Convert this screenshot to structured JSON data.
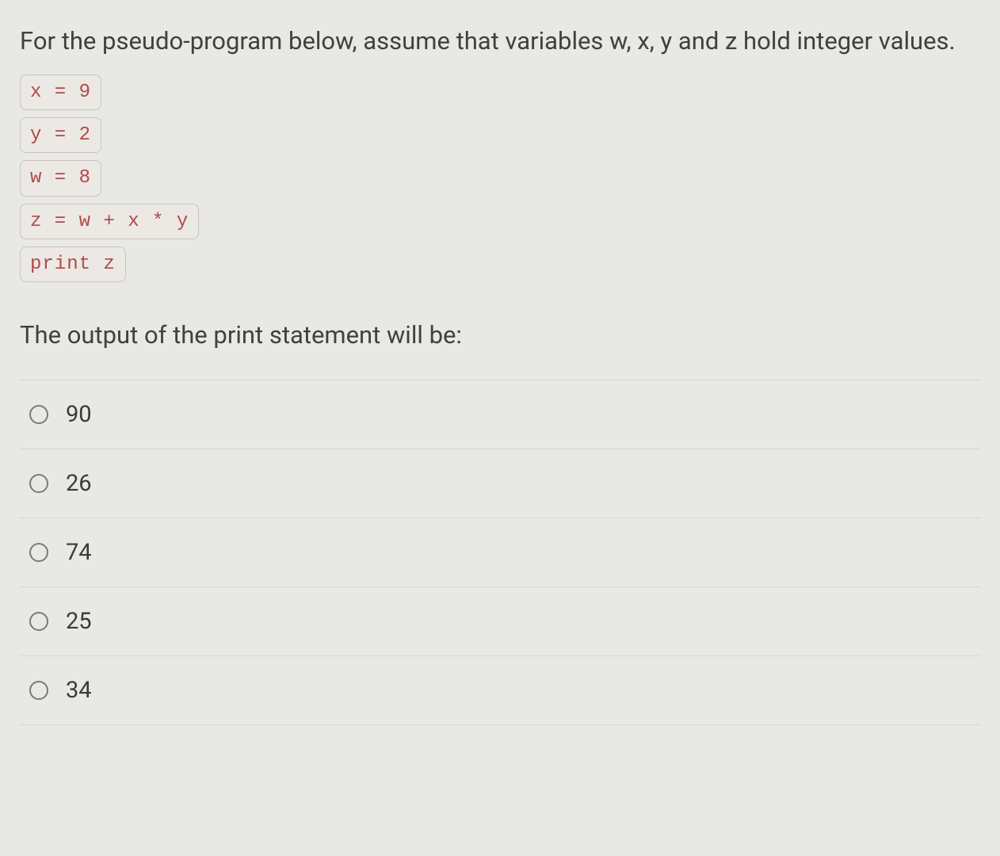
{
  "question": {
    "intro": "For the pseudo-program below, assume that variables w, x, y and z hold integer values.",
    "code_lines": [
      "x = 9",
      "y = 2",
      "w = 8",
      "z = w + x * y",
      "print z"
    ],
    "prompt": "The output of the print statement will be:"
  },
  "options": [
    {
      "label": "90"
    },
    {
      "label": "26"
    },
    {
      "label": "74"
    },
    {
      "label": "25"
    },
    {
      "label": "34"
    }
  ]
}
